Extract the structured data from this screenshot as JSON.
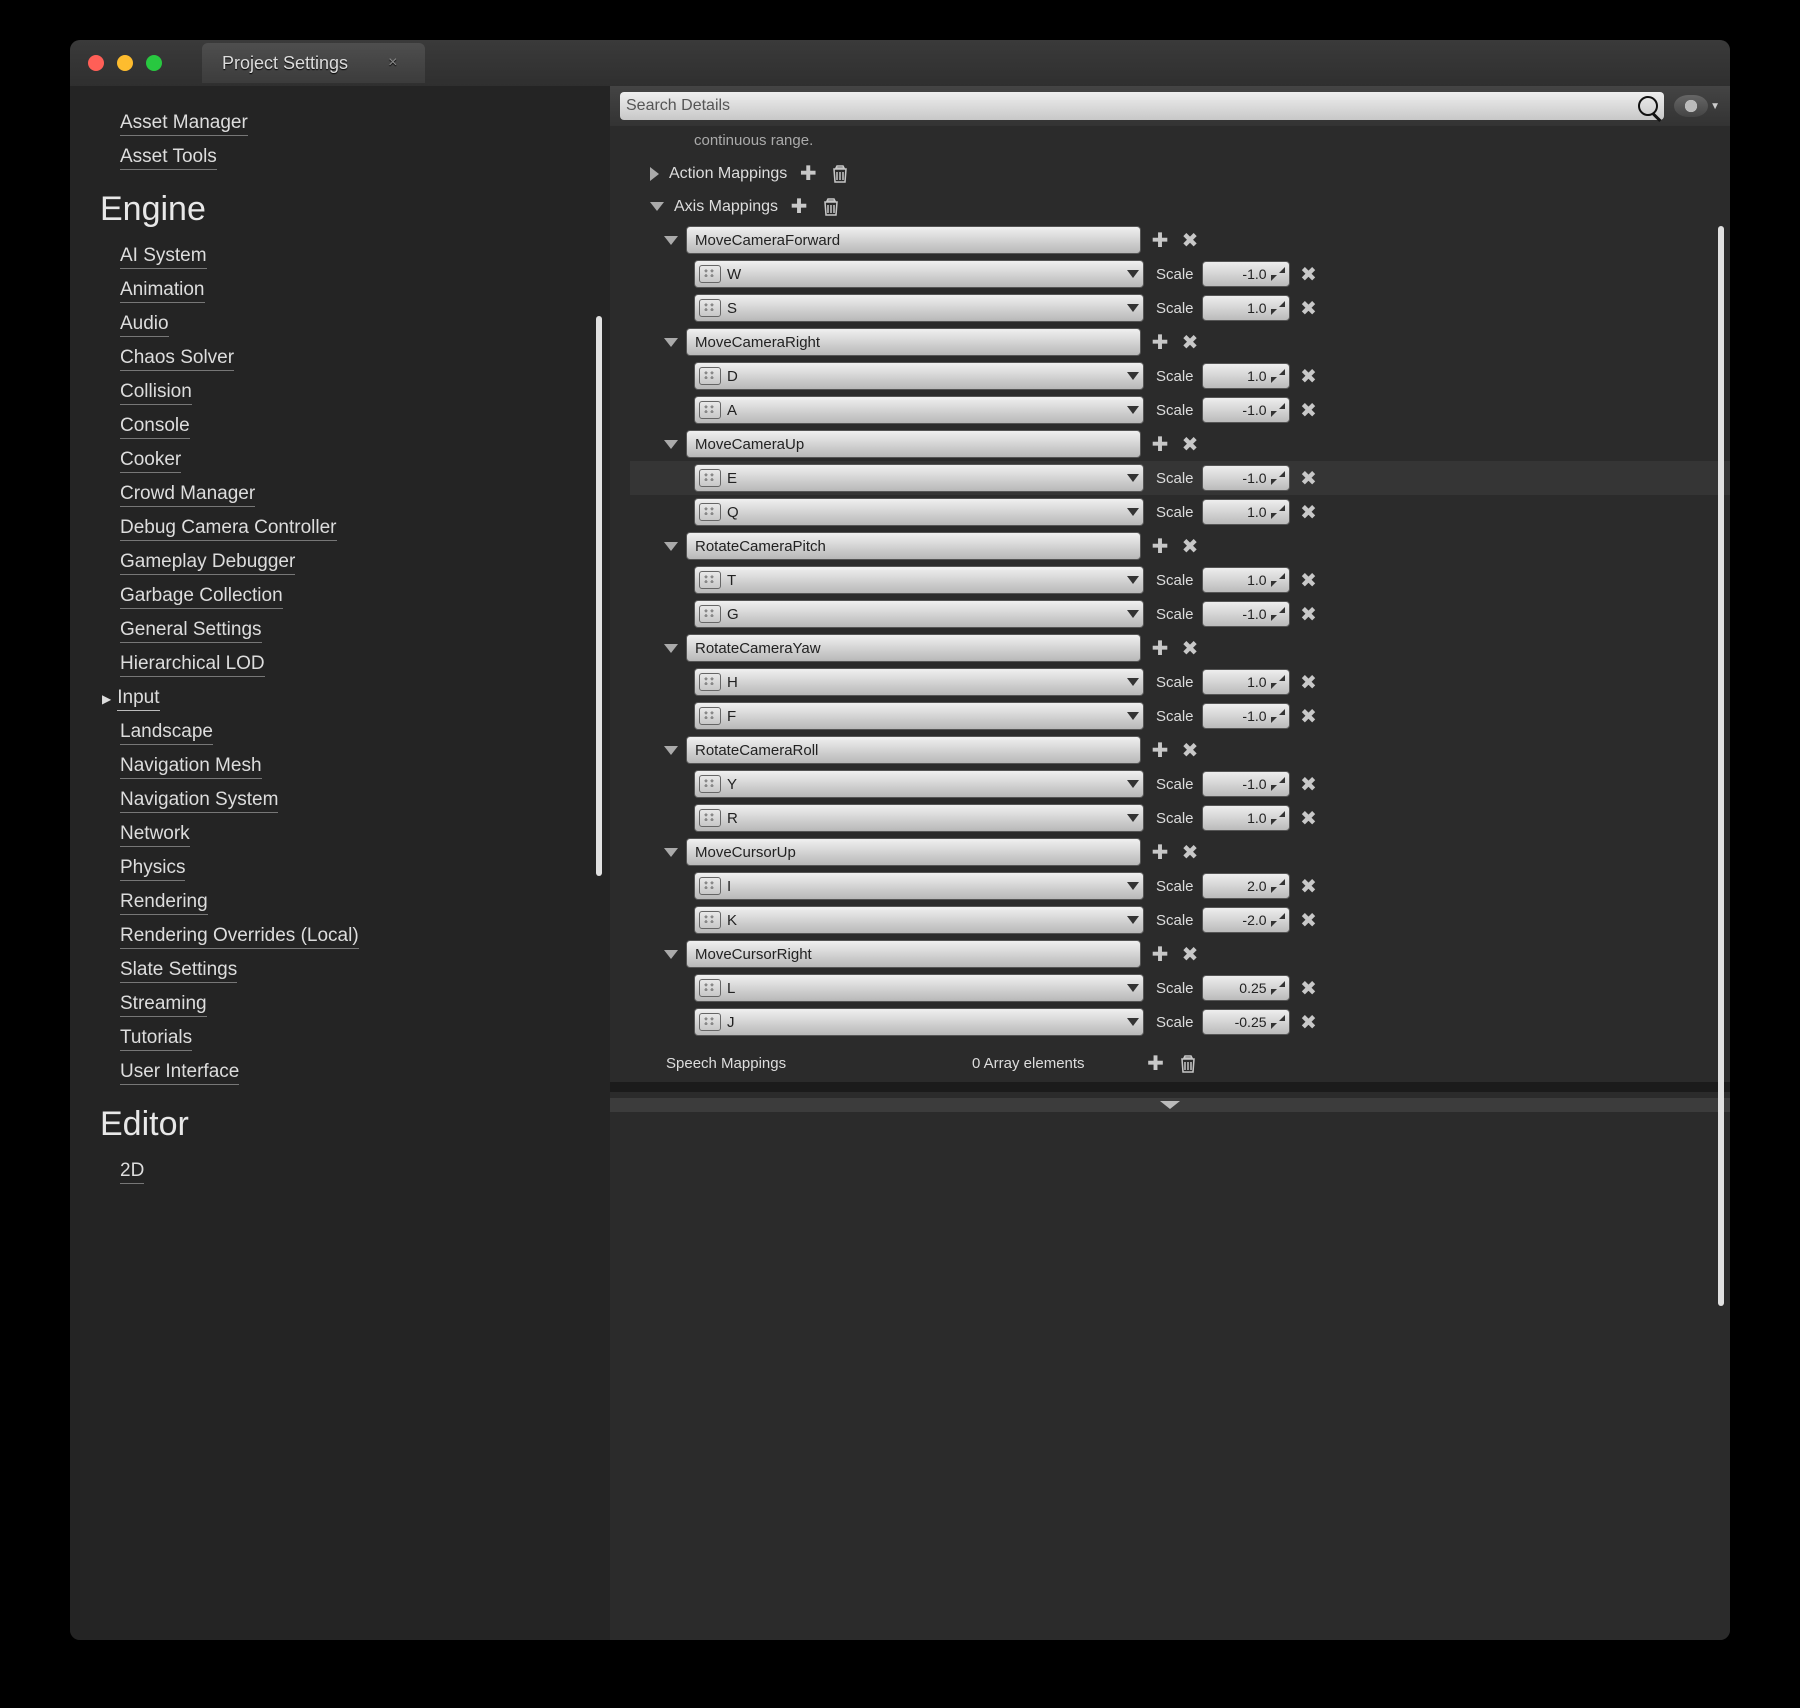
{
  "tab_title": "Project Settings",
  "sidebar": {
    "top_items": [
      "Asset Manager",
      "Asset Tools"
    ],
    "engine_title": "Engine",
    "engine_items": [
      {
        "label": "AI System"
      },
      {
        "label": "Animation"
      },
      {
        "label": "Audio"
      },
      {
        "label": "Chaos Solver"
      },
      {
        "label": "Collision"
      },
      {
        "label": "Console"
      },
      {
        "label": "Cooker"
      },
      {
        "label": "Crowd Manager"
      },
      {
        "label": "Debug Camera Controller"
      },
      {
        "label": "Gameplay Debugger"
      },
      {
        "label": "Garbage Collection"
      },
      {
        "label": "General Settings"
      },
      {
        "label": "Hierarchical LOD"
      },
      {
        "label": "Input",
        "selected": true
      },
      {
        "label": "Landscape"
      },
      {
        "label": "Navigation Mesh"
      },
      {
        "label": "Navigation System"
      },
      {
        "label": "Network"
      },
      {
        "label": "Physics"
      },
      {
        "label": "Rendering"
      },
      {
        "label": "Rendering Overrides (Local)"
      },
      {
        "label": "Slate Settings"
      },
      {
        "label": "Streaming"
      },
      {
        "label": "Tutorials"
      },
      {
        "label": "User Interface"
      }
    ],
    "editor_title": "Editor",
    "editor_items": [
      {
        "label": "2D"
      }
    ]
  },
  "search_placeholder": "Search Details",
  "hint_text": "continuous range.",
  "action_mappings_label": "Action Mappings",
  "axis_mappings_label": "Axis Mappings",
  "scale_label": "Scale",
  "axes": [
    {
      "name": "MoveCameraForward",
      "bindings": [
        {
          "key": "W",
          "scale": "-1.0"
        },
        {
          "key": "S",
          "scale": "1.0"
        }
      ]
    },
    {
      "name": "MoveCameraRight",
      "bindings": [
        {
          "key": "D",
          "scale": "1.0"
        },
        {
          "key": "A",
          "scale": "-1.0"
        }
      ]
    },
    {
      "name": "MoveCameraUp",
      "bindings": [
        {
          "key": "E",
          "scale": "-1.0",
          "highlight": true
        },
        {
          "key": "Q",
          "scale": "1.0"
        }
      ]
    },
    {
      "name": "RotateCameraPitch",
      "bindings": [
        {
          "key": "T",
          "scale": "1.0"
        },
        {
          "key": "G",
          "scale": "-1.0"
        }
      ]
    },
    {
      "name": "RotateCameraYaw",
      "bindings": [
        {
          "key": "H",
          "scale": "1.0"
        },
        {
          "key": "F",
          "scale": "-1.0"
        }
      ]
    },
    {
      "name": "RotateCameraRoll",
      "bindings": [
        {
          "key": "Y",
          "scale": "-1.0"
        },
        {
          "key": "R",
          "scale": "1.0"
        }
      ]
    },
    {
      "name": "MoveCursorUp",
      "bindings": [
        {
          "key": "I",
          "scale": "2.0"
        },
        {
          "key": "K",
          "scale": "-2.0"
        }
      ]
    },
    {
      "name": "MoveCursorRight",
      "bindings": [
        {
          "key": "L",
          "scale": "0.25"
        },
        {
          "key": "J",
          "scale": "-0.25"
        }
      ]
    }
  ],
  "speech_mappings_label": "Speech Mappings",
  "speech_mappings_value": "0 Array elements"
}
